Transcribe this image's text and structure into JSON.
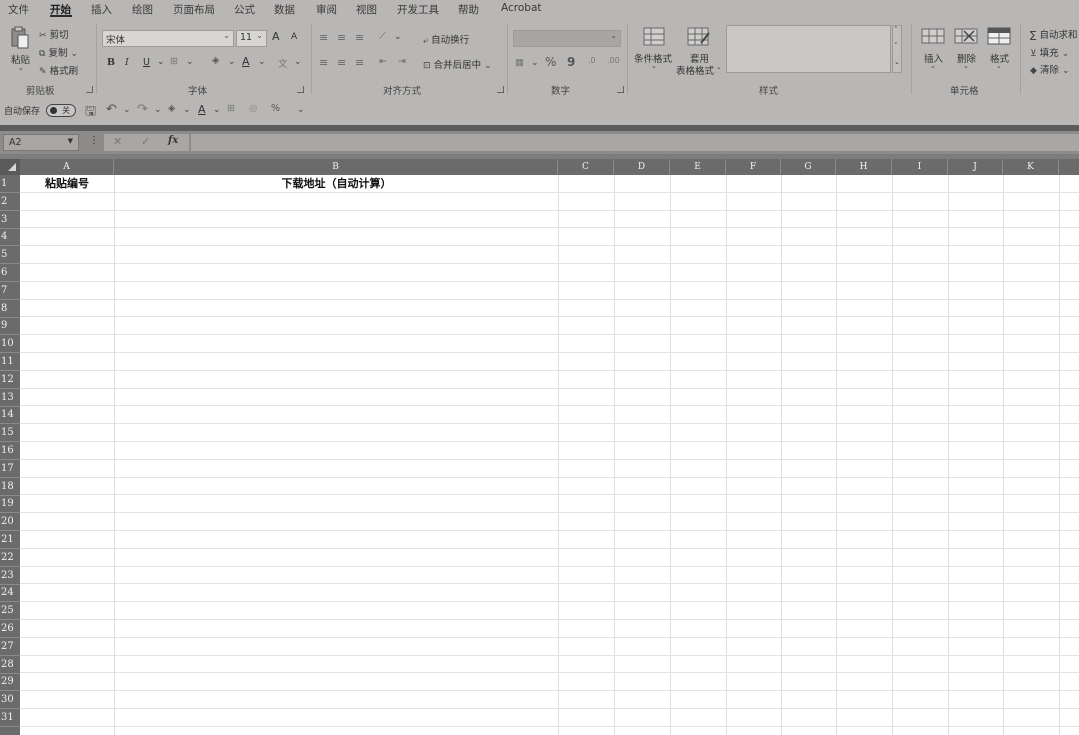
{
  "menu": {
    "tabs": [
      "文件",
      "开始",
      "插入",
      "绘图",
      "页面布局",
      "公式",
      "数据",
      "审阅",
      "视图",
      "开发工具",
      "帮助",
      "Acrobat"
    ],
    "active": "开始"
  },
  "clipboard": {
    "paste": "粘贴",
    "cut": "剪切",
    "copy": "复制",
    "format_painter": "格式刷",
    "group": "剪贴板"
  },
  "font": {
    "name": "宋体",
    "size": "11",
    "grow": "A",
    "shrink": "A",
    "bold": "B",
    "italic": "I",
    "underline": "U",
    "color_letter": "A",
    "group": "字体"
  },
  "alignment": {
    "wrap_text": "自动换行",
    "merge_center": "合并后居中",
    "group": "对齐方式"
  },
  "number": {
    "format": "",
    "percent": "%",
    "comma": "9",
    "group": "数字"
  },
  "styles": {
    "conditional": "条件格式",
    "table_line1": "套用",
    "table_line2": "表格格式",
    "group": "样式"
  },
  "cells": {
    "insert": "插入",
    "delete": "删除",
    "format": "格式",
    "group": "单元格"
  },
  "editing": {
    "autosum": "自动求和",
    "fill": "填充",
    "clear": "清除"
  },
  "qat": {
    "autosave": "自动保存",
    "toggle": "关"
  },
  "formula_bar": {
    "name_box": "A2",
    "fx": "fx",
    "value": ""
  },
  "sheet": {
    "columns": [
      "A",
      "B",
      "C",
      "D",
      "E",
      "F",
      "G",
      "H",
      "I",
      "J",
      "K"
    ],
    "rows": [
      "1",
      "2",
      "3",
      "4",
      "5",
      "6",
      "7",
      "8",
      "9",
      "10",
      "11",
      "12",
      "13",
      "14",
      "15",
      "16",
      "17",
      "18",
      "19",
      "20",
      "21",
      "22",
      "23",
      "24",
      "25",
      "26",
      "27",
      "28",
      "29",
      "30",
      "31"
    ],
    "cells": {
      "A1": "粘贴编号",
      "B1": "下载地址（自动计算）"
    }
  }
}
